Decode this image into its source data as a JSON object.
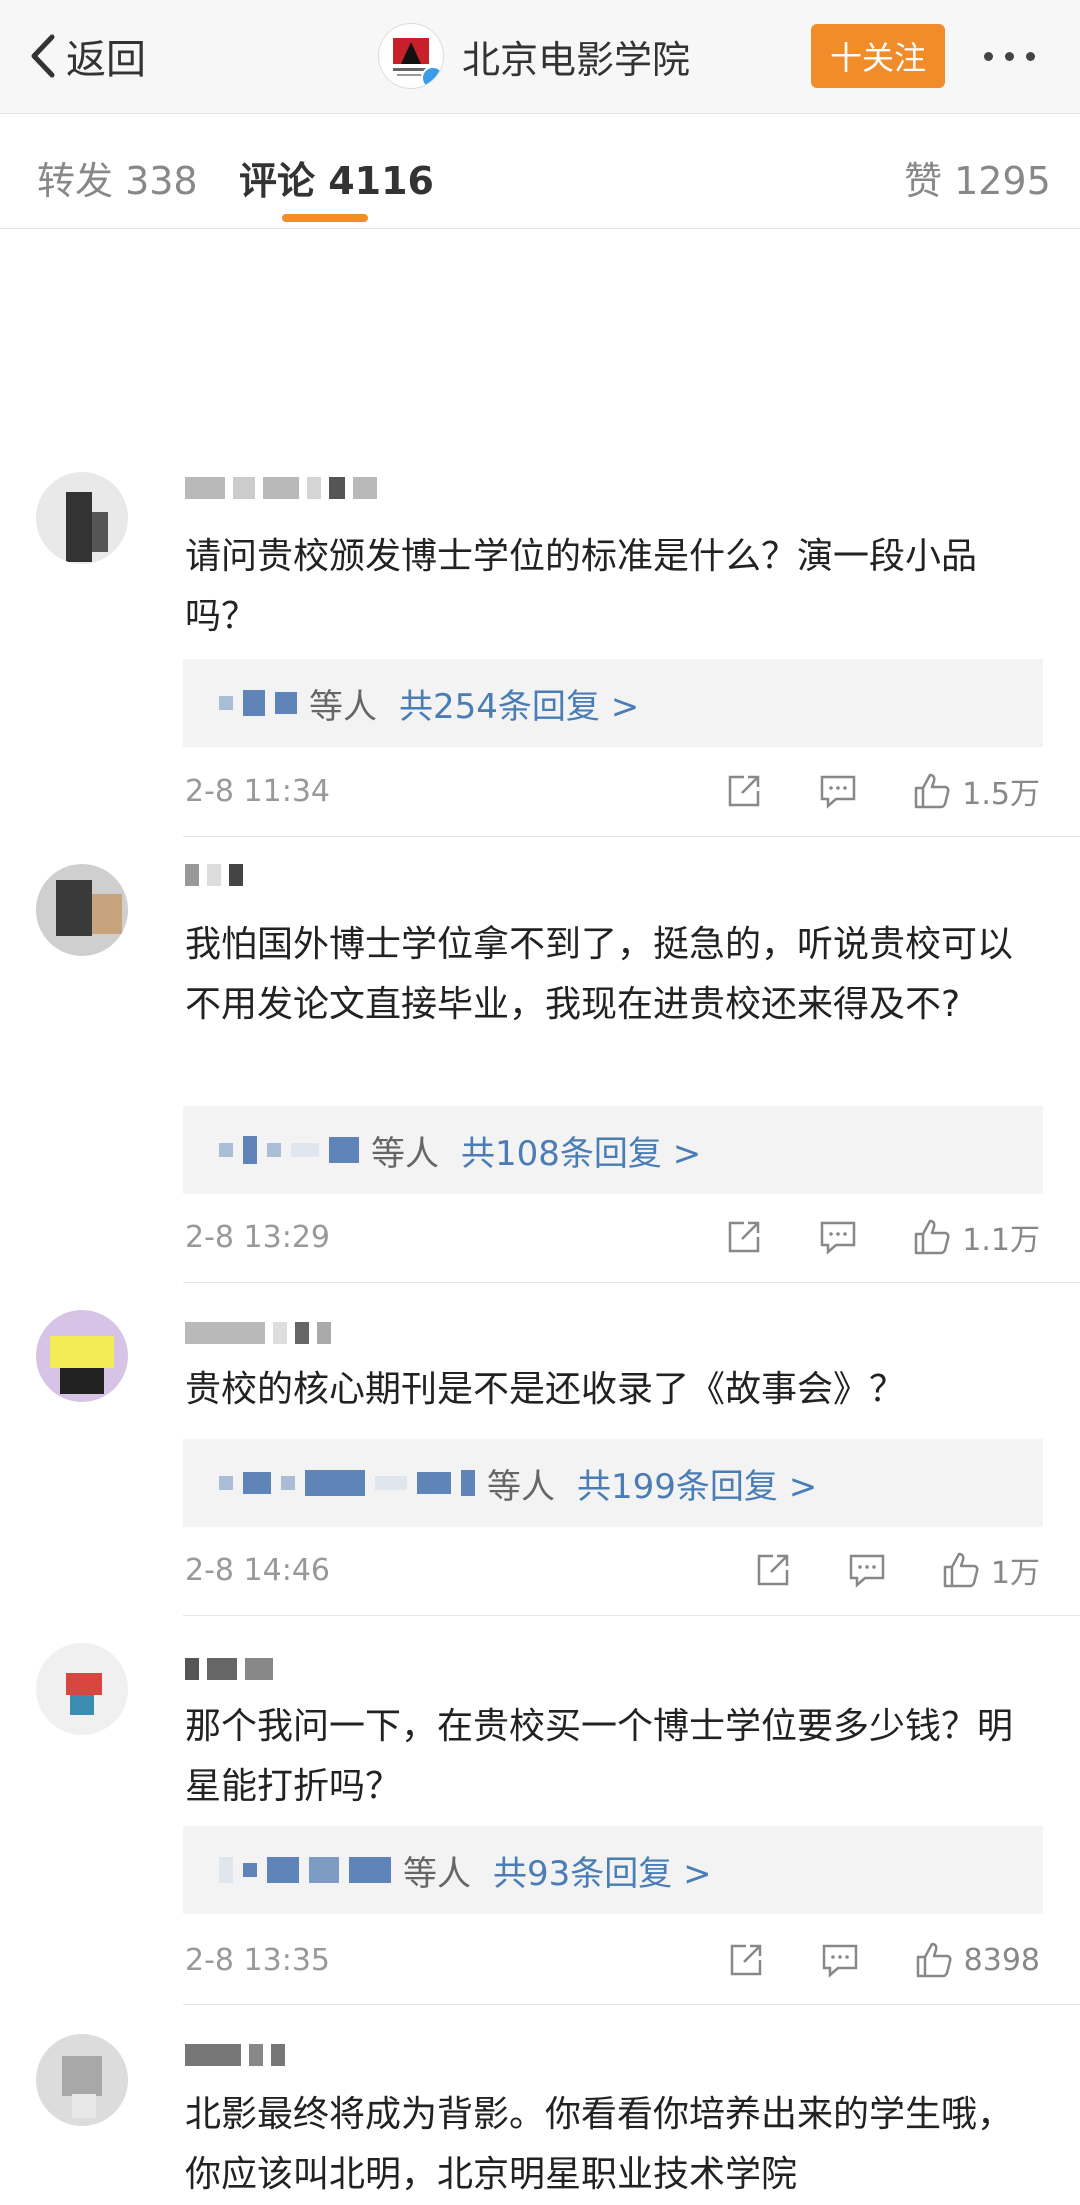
{
  "header": {
    "back_label": "返回",
    "account_name": "北京电影学院",
    "follow_label": "十关注"
  },
  "tabs": [
    {
      "label": "转发 338"
    },
    {
      "label": "评论 4116"
    },
    {
      "label": "赞 1295"
    }
  ],
  "comments": [
    {
      "text": "请问贵校颁发博士学位的标准是什么？演一段小品吗？",
      "who": "等人",
      "reply_count": "共254条回复 >",
      "time": "2-8 11:34",
      "likes": "1.5万"
    },
    {
      "text": "我怕国外博士学位拿不到了，挺急的，听说贵校可以不用发论文直接毕业，我现在进贵校还来得及不?",
      "who": "等人",
      "reply_count": "共108条回复 >",
      "time": "2-8 13:29",
      "likes": "1.1万"
    },
    {
      "text": "贵校的核心期刊是不是还收录了《故事会》？",
      "who": "等人",
      "reply_count": "共199条回复 >",
      "time": "2-8 14:46",
      "likes": "1万"
    },
    {
      "text": "那个我问一下，在贵校买一个博士学位要多少钱？明星能打折吗？",
      "who": "等人",
      "reply_count": "共93条回复 >",
      "time": "2-8 13:35",
      "likes": "8398"
    },
    {
      "text": "北影最终将成为背影。你看看你培养出来的学生哦，你应该叫北明，北京明星职业技术学院"
    }
  ]
}
